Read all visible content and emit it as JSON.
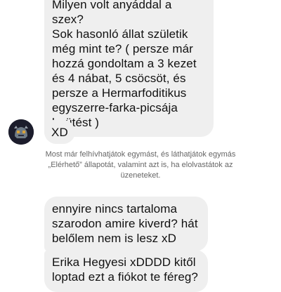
{
  "conversation": {
    "messages": [
      {
        "text": "Milyen volt anyáddal a szex?\nSok hasonló állat születik\nmég mint te? ( persze már\nhozzá gondoltam a 3 kezet\nés 4 nábat, 5 csöcsöt, és\npersze a Hermarfoditikus\negyszerre-farka-picsája\nbeütést )"
      },
      {
        "text": "XD"
      },
      {
        "text": "ennyire nincs tartaloma\nszarodon amire kiverd? hát\nbelőlem nem is lesz xD"
      },
      {
        "text": "Erika Hegyesi xDDDD kitől\nloptad ezt a fiókot te féreg?"
      }
    ],
    "notice": "Most már felhívhatjátok egymást, és láthatjátok egymás\n„Elérhető” állapotát, valamint azt is, ha elolvastátok az\nüzeneteket.",
    "avatar_icon": "skull-avatar-icon",
    "colors": {
      "bubble": "#efefef",
      "text": "#111111",
      "notice": "#666666"
    }
  }
}
